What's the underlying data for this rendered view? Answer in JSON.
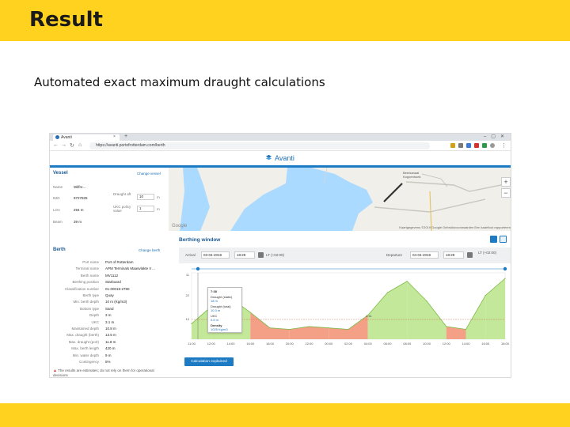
{
  "slide": {
    "title": "Result",
    "subtitle": "Automated exact maximum draught calculations"
  },
  "browser": {
    "tab_title": "Avanti",
    "tab_close": "×",
    "tab_new": "+",
    "url": "https://avanti.portofrotterdam.com/berth",
    "back": "←",
    "forward": "→",
    "reload": "↻",
    "home": "⌂"
  },
  "app": {
    "brand": "Avanti",
    "brand_color": "#1d6fb5"
  },
  "vessel": {
    "title": "Vessel",
    "change_link": "Change vessel",
    "name_label": "Name",
    "name_value": "Wilfre…",
    "imo_label": "IMO",
    "imo_value": "9727825",
    "loa_label": "LOA",
    "loa_value": "294 m",
    "beam_label": "Beam",
    "beam_value": "39 m",
    "draught_aft_label": "Draught aft",
    "draught_aft_value": "10",
    "draught_aft_unit": "m",
    "ukc_label": "UKC policy value",
    "ukc_value": "1",
    "ukc_unit": "m"
  },
  "map": {
    "google": "Google",
    "attribution": "Kaartgegevens ©2019 Google   Gebruiksvoorwaarden   Een kaartfout rapporteren",
    "place_label": "Beerkanaal Koppenhoek"
  },
  "berth": {
    "title": "Berth",
    "change_link": "Change berth",
    "rows": [
      {
        "label": "Port name",
        "value": "Port of Rotterdam"
      },
      {
        "label": "Terminal name",
        "value": "APM Terminals Maasvlakte II ..."
      },
      {
        "label": "Berth name",
        "value": "MV1112"
      },
      {
        "label": "Berthing position",
        "value": "Starboard"
      },
      {
        "label": "Classification number",
        "value": "01-00018-2780"
      },
      {
        "label": "Berth type",
        "value": "Quay"
      },
      {
        "label": "Min. berth depth",
        "value": "10 m (Kg/m3)"
      },
      {
        "label": "Bottom type",
        "value": "Sand"
      },
      {
        "label": "Depth",
        "value": "3 m"
      },
      {
        "label": "UKC",
        "value": "3.1 m"
      },
      {
        "label": "Maintained depth",
        "value": "10.8 m"
      },
      {
        "label": "Max. draught (berth)",
        "value": "13.5 m"
      },
      {
        "label": "Max. draught (port)",
        "value": "11.8 m"
      },
      {
        "label": "Max. berth length",
        "value": "420 m"
      },
      {
        "label": "Min. water depth",
        "value": "9 m"
      },
      {
        "label": "Contingency",
        "value": "5%"
      }
    ],
    "warning": "The results are estimates; do not rely on them for operational decisions"
  },
  "berthing_window": {
    "title": "Berthing window",
    "arrival_label": "Arrival",
    "arrival_date": "03-04-2019",
    "arrival_time": "18:29",
    "arrival_tz": "LT (+02:00)",
    "departure_label": "Departure",
    "departure_date": "04-04-2019",
    "departure_time": "18:29",
    "departure_tz": "LT (+02:00)",
    "button": "Calculation explained",
    "tooltip": {
      "time": "7:38",
      "l1": "Draught (static)",
      "v1": "18 m",
      "l2": "Draught (total)",
      "v2": "10.3 m",
      "l3": "UKC",
      "v3": "0.5 m",
      "l4": "Density",
      "v4": "1025 Kg/m3"
    },
    "chart_value_label": "1.41",
    "colors": {
      "green": "#c4e89a",
      "green_line": "#7cbb46",
      "red": "#f4a087",
      "accent": "#1d7bc4"
    }
  },
  "chart_data": {
    "type": "area",
    "title": "",
    "xlabel": "",
    "ylabel": "",
    "yticks": [
      "11",
      "22",
      "10"
    ],
    "x": [
      "11:00",
      "12:00",
      "14:00",
      "16:00",
      "18:00",
      "20:00",
      "22:00",
      "00:00",
      "02:00",
      "04:00",
      "06:00",
      "08:00",
      "10:00",
      "12:00",
      "14:00",
      "16:00",
      "18:00"
    ],
    "series": [
      {
        "values": [
          9.6,
          10.8,
          11.4,
          10.4,
          9.3,
          9.2,
          9.4,
          9.3,
          9.2,
          10.2,
          11.8,
          12.6,
          11.2,
          9.4,
          9.2,
          11.6,
          12.8
        ]
      }
    ],
    "threshold": 9.9
  }
}
